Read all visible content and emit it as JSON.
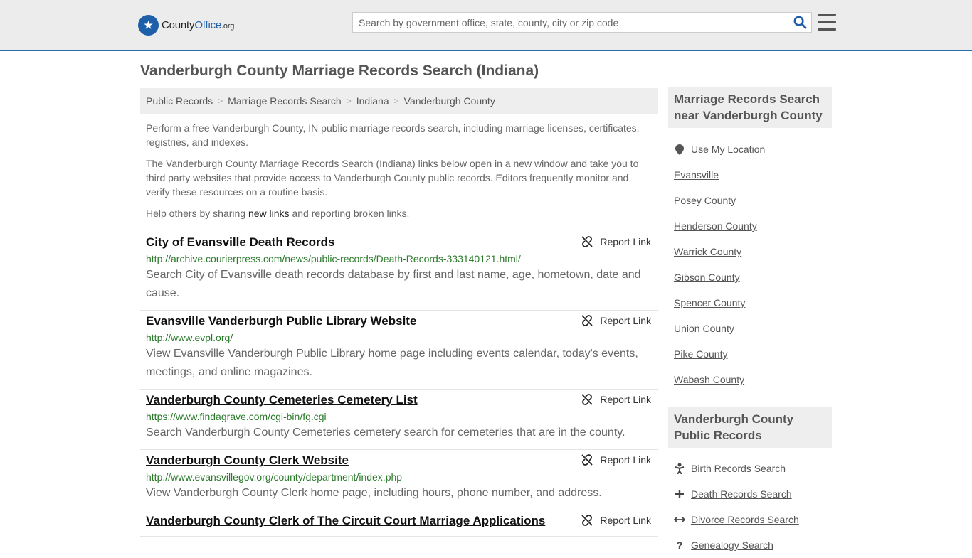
{
  "header": {
    "logo_main": "County",
    "logo_accent": "Office",
    "logo_suffix": ".org",
    "search_placeholder": "Search by government office, state, county, city or zip code"
  },
  "page_title": "Vanderburgh County Marriage Records Search (Indiana)",
  "breadcrumb": [
    "Public Records",
    "Marriage Records Search",
    "Indiana",
    "Vanderburgh County"
  ],
  "intro": {
    "p1": "Perform a free Vanderburgh County, IN public marriage records search, including marriage licenses, certificates, registries, and indexes.",
    "p2": "The Vanderburgh County Marriage Records Search (Indiana) links below open in a new window and take you to third party websites that provide access to Vanderburgh County public records. Editors frequently monitor and verify these resources on a routine basis.",
    "p3_pre": "Help others by sharing ",
    "p3_link": "new links",
    "p3_post": " and reporting broken links."
  },
  "report_label": "Report Link",
  "results": [
    {
      "title": "City of Evansville Death Records",
      "url": "http://archive.courierpress.com/news/public-records/Death-Records-333140121.html/",
      "desc": "Search City of Evansville death records database by first and last name, age, hometown, date and cause."
    },
    {
      "title": "Evansville Vanderburgh Public Library Website",
      "url": "http://www.evpl.org/",
      "desc": "View Evansville Vanderburgh Public Library home page including events calendar, today's events, meetings, and online magazines."
    },
    {
      "title": "Vanderburgh County Cemeteries Cemetery List",
      "url": "https://www.findagrave.com/cgi-bin/fg.cgi",
      "desc": "Search Vanderburgh County Cemeteries cemetery search for cemeteries that are in the county."
    },
    {
      "title": "Vanderburgh County Clerk Website",
      "url": "http://www.evansvillegov.org/county/department/index.php",
      "desc": "View Vanderburgh County Clerk home page, including hours, phone number, and address."
    },
    {
      "title": "Vanderburgh County Clerk of The Circuit Court Marriage Applications",
      "url": "",
      "desc": ""
    }
  ],
  "sidebar": {
    "nearby_heading": "Marriage Records Search near Vanderburgh County",
    "use_location": "Use My Location",
    "nearby": [
      "Evansville",
      "Posey County",
      "Henderson County",
      "Warrick County",
      "Gibson County",
      "Spencer County",
      "Union County",
      "Pike County",
      "Wabash County"
    ],
    "public_heading": "Vanderburgh County Public Records",
    "public_records": [
      {
        "label": "Birth Records Search",
        "icon": "baby-icon"
      },
      {
        "label": "Death Records Search",
        "icon": "cross-icon"
      },
      {
        "label": "Divorce Records Search",
        "icon": "arrows-icon"
      },
      {
        "label": "Genealogy Search",
        "icon": "question-icon"
      }
    ]
  }
}
